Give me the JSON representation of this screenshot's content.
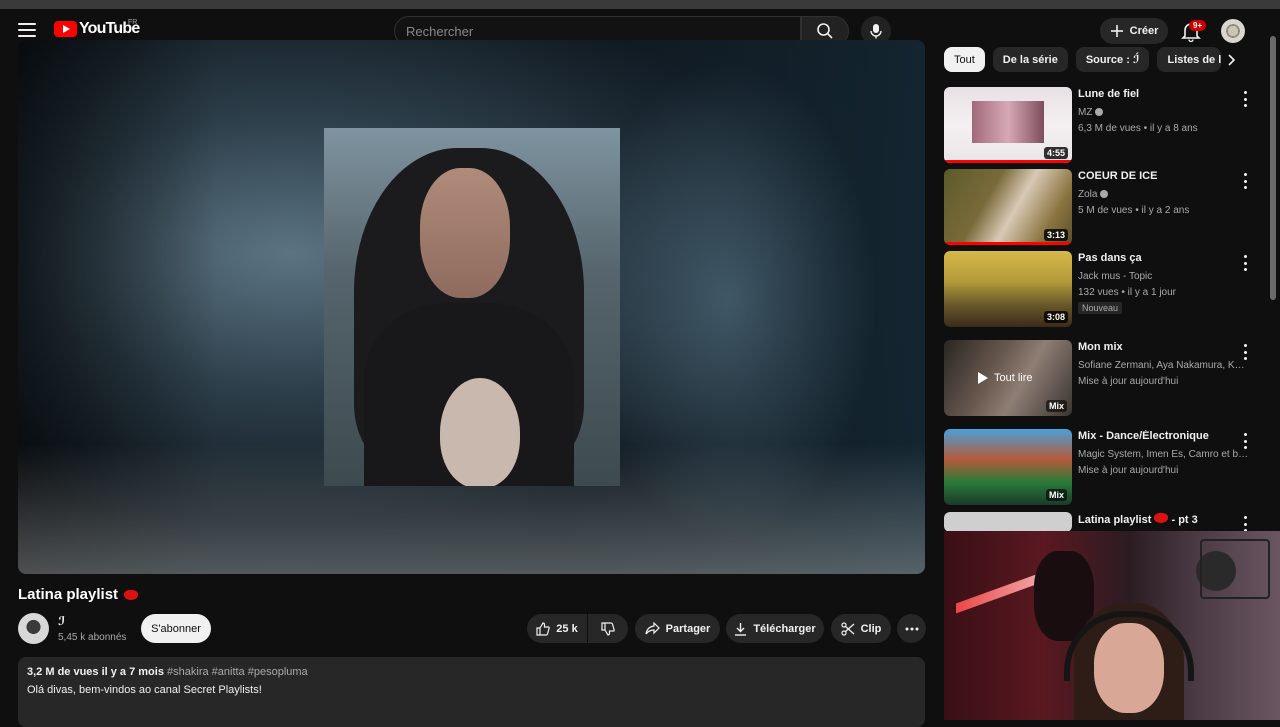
{
  "header": {
    "logo_text": "YouTube",
    "country": "FR",
    "search_placeholder": "Rechercher",
    "create_label": "Créer",
    "notifications_badge": "9+"
  },
  "video": {
    "title": "Latina playlist",
    "channel_name": "ℐ",
    "subscribers": "5,45 k abonnés",
    "subscribe_label": "S'abonner",
    "likes": "25 k",
    "share_label": "Partager",
    "download_label": "Télécharger",
    "clip_label": "Clip",
    "views_date": "3,2 M de vues  il y a 7 mois",
    "hashtags": "#shakira #anitta #pesopluma",
    "description": "Olá divas, bem-vindos ao canal Secret Playlists!"
  },
  "chips": [
    "Tout",
    "De la série",
    "Source : ℐ́",
    "Listes de le"
  ],
  "recommendations": [
    {
      "title": "Lune de fiel",
      "channel": "MZ",
      "verified": true,
      "meta": "6,3 M de vues • il y a 8 ans",
      "duration": "4:55"
    },
    {
      "title": "COEUR DE ICE",
      "channel": "Zola",
      "verified": true,
      "meta": "5 M de vues • il y a 2 ans",
      "duration": "3:13"
    },
    {
      "title": "Pas dans ça",
      "channel": "Jack mus - Topic",
      "verified": false,
      "meta": "132 vues • il y a 1 jour",
      "duration": "3:08",
      "badge": "Nouveau"
    },
    {
      "title": "Mon mix",
      "channel": "Sofiane Zermani, Aya Nakamura, KeBlac...",
      "meta": "Mise à jour aujourd'hui",
      "overlay": "Tout lire",
      "mix": "Mix"
    },
    {
      "title": "Mix - Dance/Électronique",
      "channel": "Magic System, Imen Es, Camro et bien pl...",
      "meta": "Mise à jour aujourd'hui",
      "mix": "Mix"
    },
    {
      "title": "Latina playlist",
      "suffix": " - pt 3"
    }
  ]
}
